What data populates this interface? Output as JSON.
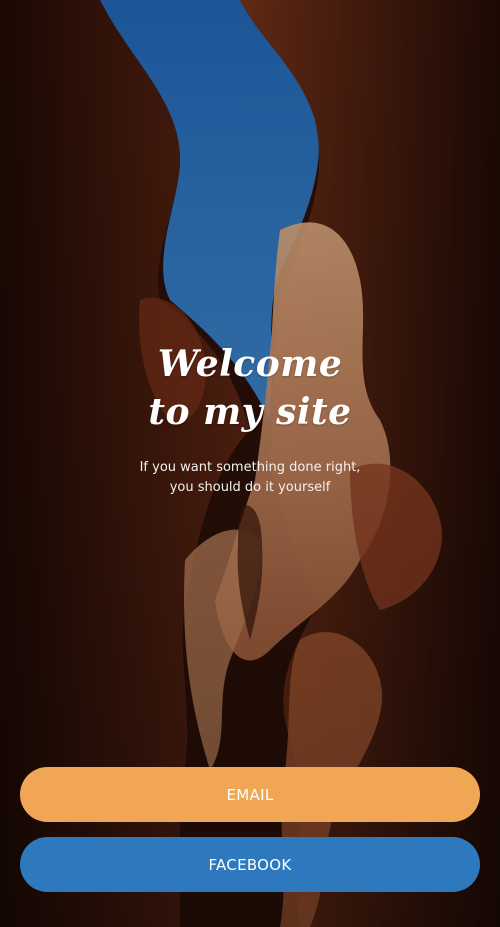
{
  "hero": {
    "title": "Welcome to my site",
    "subtitle": "If you want something done right, you should do it yourself"
  },
  "buttons": {
    "email_label": "EMAIL",
    "facebook_label": "FACEBOOK"
  },
  "colors": {
    "email_button": "#f0a654",
    "facebook_button": "#2e78bd",
    "sky": "#2d6fb6"
  }
}
